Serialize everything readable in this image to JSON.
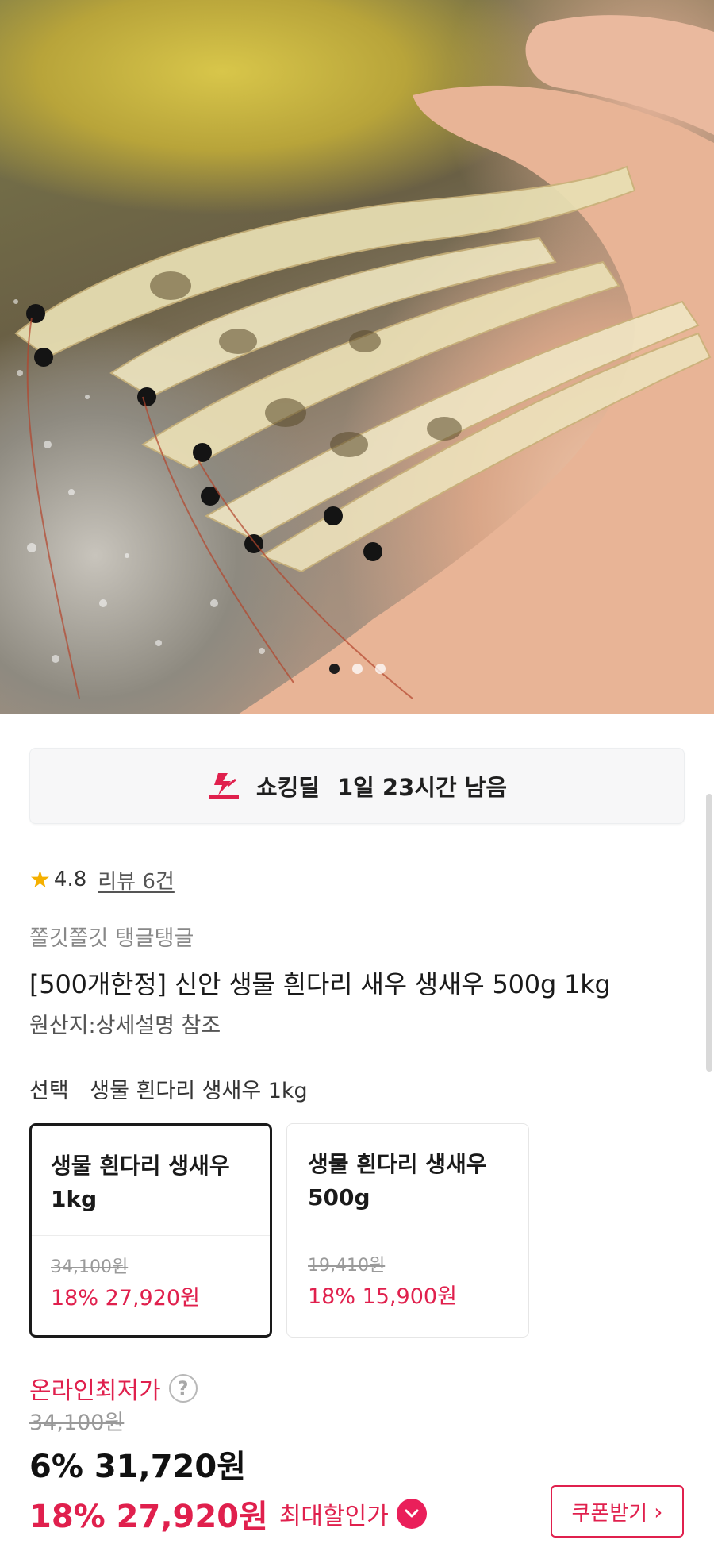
{
  "gallery": {
    "image_description_icon": "shrimp-photo",
    "page_count": 3,
    "active_index": 0
  },
  "deal": {
    "label": "쇼킹딜",
    "time_left": "1일 23시간 남음",
    "icon": "shocking-deal-logo-icon"
  },
  "rating": {
    "score": "4.8",
    "reviews_label": "리뷰 6건"
  },
  "product": {
    "subtitle": "쫄깃쫄깃 탱글탱글",
    "title": "[500개한정] 신안 생물 흰다리 새우 생새우 500g 1kg",
    "origin": "원산지:상세설명 참조"
  },
  "selection": {
    "label": "선택",
    "value": "생물 흰다리 생새우 1kg",
    "options": [
      {
        "name": "생물 흰다리 생새우 1kg",
        "original_price": "34,100원",
        "sale": "18% 27,920원",
        "selected": true
      },
      {
        "name": "생물 흰다리 생새우 500g",
        "original_price": "19,410원",
        "sale": "18% 15,900원",
        "selected": false
      }
    ]
  },
  "pricing": {
    "lowest_label": "온라인최저가",
    "original_price": "34,100원",
    "discount_price": "6% 31,720원",
    "max_discount_price": "18% 27,920원",
    "max_discount_label": "최대할인가",
    "coupon_button": "쿠폰받기"
  },
  "colors": {
    "accent": "#e0204d",
    "star": "#f5b000"
  }
}
